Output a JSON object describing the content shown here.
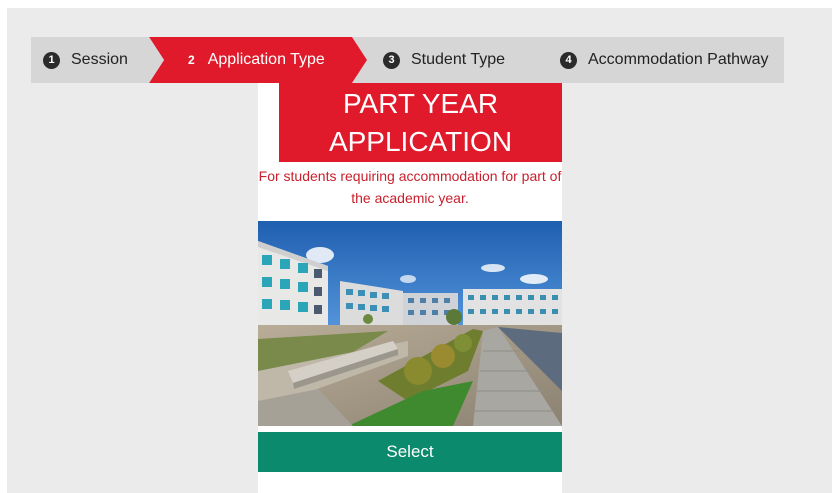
{
  "stepper": {
    "steps": [
      {
        "number": "1",
        "label": "Session"
      },
      {
        "number": "2",
        "label": "Application Type"
      },
      {
        "number": "3",
        "label": "Student Type"
      },
      {
        "number": "4",
        "label": "Accommodation Pathway"
      }
    ],
    "active_step": 2
  },
  "card": {
    "title_line1": "PART YEAR",
    "title_line2": "APPLICATION",
    "description": "For students requiring accommodation for part of the academic year.",
    "select_label": "Select"
  },
  "colors": {
    "accent_red": "#e01a2b",
    "description_red": "#c8202c",
    "button_green": "#0b8a6d",
    "step_gray": "#d6d6d6",
    "page_bg": "#ebebeb"
  }
}
